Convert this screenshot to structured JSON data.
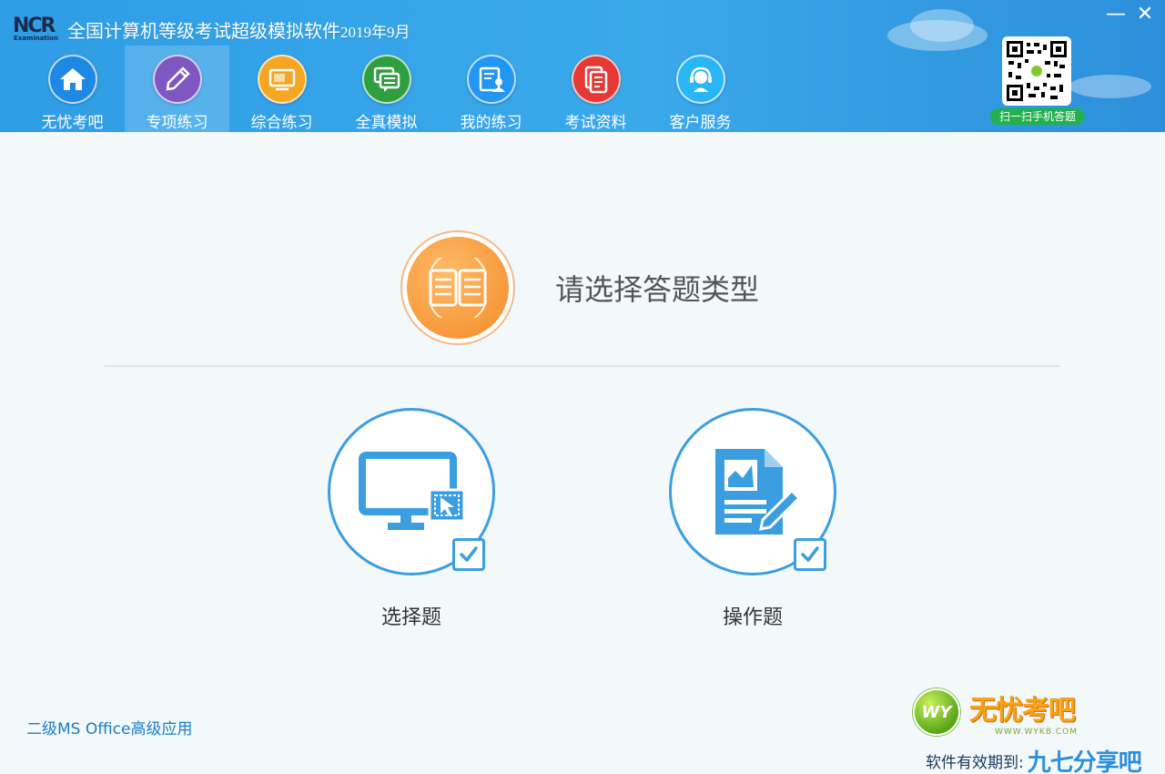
{
  "app": {
    "logo_text": "NCR",
    "logo_sub": "Examination",
    "title_main": "全国计算机等级考试超级模拟软件",
    "title_suffix": "2019年9月"
  },
  "window_controls": {
    "minimize": "—",
    "close": "✕"
  },
  "nav": {
    "items": [
      {
        "label": "无忧考吧",
        "icon": "home-icon",
        "color": "#1e88e5"
      },
      {
        "label": "专项练习",
        "icon": "pencil-icon",
        "color": "#7e57c2"
      },
      {
        "label": "综合练习",
        "icon": "monitor-icon",
        "color": "#f5a623"
      },
      {
        "label": "全真模拟",
        "icon": "chat-icon",
        "color": "#2e9e3e"
      },
      {
        "label": "我的练习",
        "icon": "user-doc-icon",
        "color": "#2196f3"
      },
      {
        "label": "考试资料",
        "icon": "documents-icon",
        "color": "#e53935"
      },
      {
        "label": "客户服务",
        "icon": "headset-icon",
        "color": "#29b6f6"
      }
    ],
    "active_index": 1
  },
  "qr": {
    "label": "扫一扫手机答题"
  },
  "main": {
    "title": "请选择答题类型",
    "choices": [
      {
        "label": "选择题",
        "icon": "monitor-cursor-icon"
      },
      {
        "label": "操作题",
        "icon": "document-chart-pencil-icon"
      }
    ]
  },
  "footer": {
    "subject": "二级MS Office高级应用",
    "brand_name": "无忧考吧",
    "brand_url": "WWW.WYKB.COM",
    "brand_badge": "WY",
    "validity_label": "软件有效期到:",
    "watermark": "九七分享吧"
  },
  "colors": {
    "header": "#2e9de6",
    "accent": "#3a9ee0",
    "orange": "#f48a2a",
    "qr_label_bg": "#22b14c"
  }
}
